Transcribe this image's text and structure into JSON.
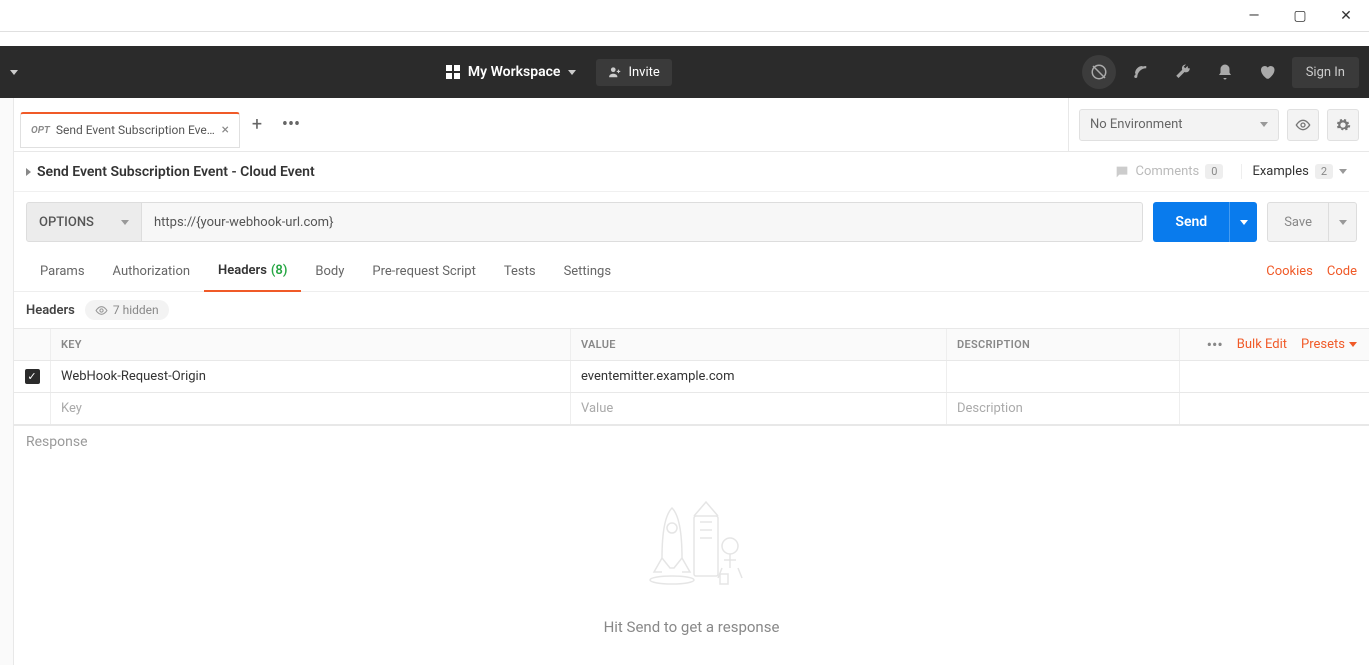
{
  "titlebar": {
    "minimize": "—",
    "maximize": "▢",
    "close": "✕"
  },
  "topbar": {
    "workspace_label": "My Workspace",
    "invite_label": "Invite",
    "signin_label": "Sign In"
  },
  "tabs": {
    "active": {
      "method": "OPT",
      "label": "Send Event Subscription Event..."
    }
  },
  "environment": {
    "selected": "No Environment"
  },
  "request": {
    "title": "Send Event Subscription Event - Cloud Event",
    "comments_label": "Comments",
    "comments_count": "0",
    "examples_label": "Examples",
    "examples_count": "2",
    "method": "OPTIONS",
    "url": "https://{your-webhook-url.com}",
    "send_label": "Send",
    "save_label": "Save"
  },
  "req_tabs": {
    "params": "Params",
    "authorization": "Authorization",
    "headers": "Headers",
    "headers_count": "(8)",
    "body": "Body",
    "prerequest": "Pre-request Script",
    "tests": "Tests",
    "settings": "Settings",
    "cookies": "Cookies",
    "code": "Code"
  },
  "headers_section": {
    "label": "Headers",
    "hidden_label": "7 hidden",
    "columns": {
      "key": "KEY",
      "value": "VALUE",
      "description": "DESCRIPTION"
    },
    "bulk_edit": "Bulk Edit",
    "presets": "Presets",
    "rows": [
      {
        "enabled": true,
        "key": "WebHook-Request-Origin",
        "value": "eventemitter.example.com",
        "description": ""
      }
    ],
    "placeholders": {
      "key": "Key",
      "value": "Value",
      "description": "Description"
    }
  },
  "response": {
    "label": "Response",
    "empty_hint": "Hit Send to get a response"
  }
}
